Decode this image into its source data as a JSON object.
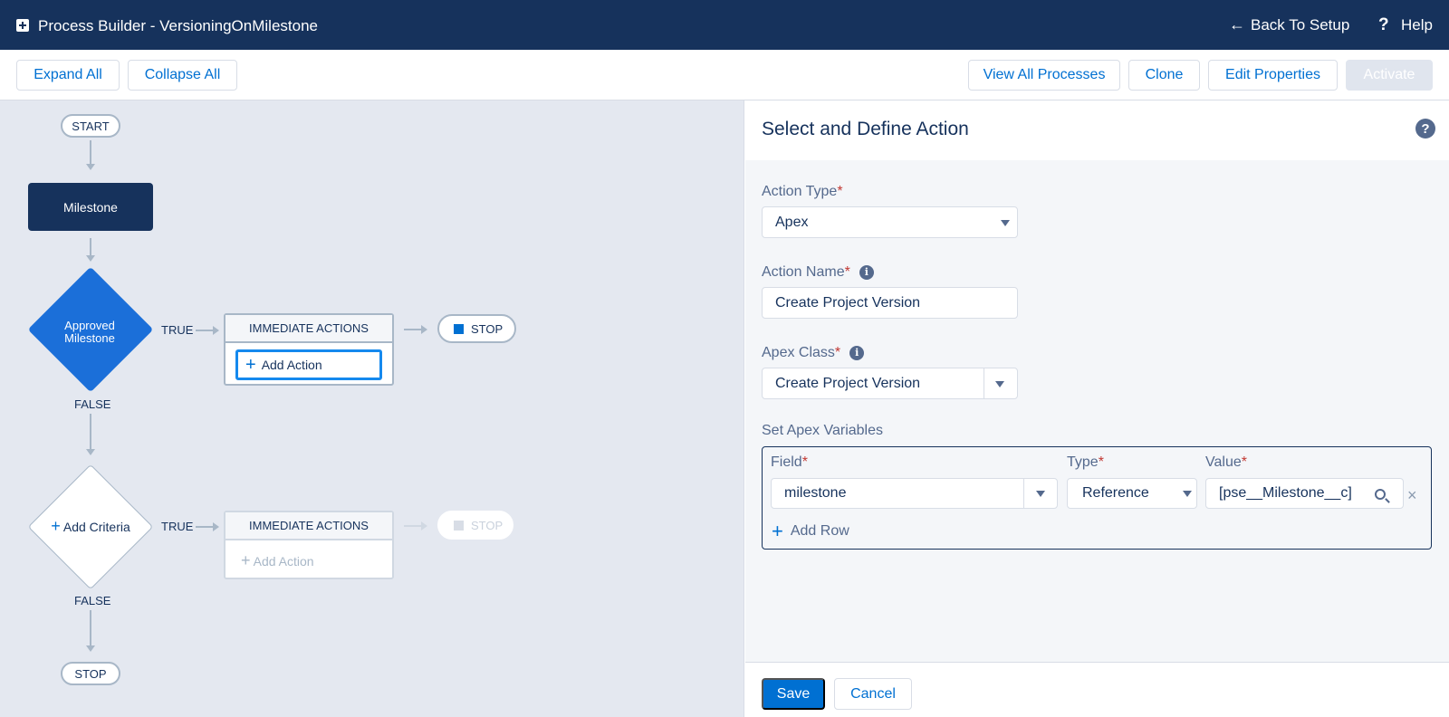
{
  "header": {
    "title": "Process Builder - VersioningOnMilestone",
    "back_label": "Back To Setup",
    "help_label": "Help"
  },
  "toolbar": {
    "expand_all": "Expand All",
    "collapse_all": "Collapse All",
    "view_all_processes": "View All Processes",
    "clone": "Clone",
    "edit_properties": "Edit Properties",
    "activate": "Activate"
  },
  "canvas": {
    "start_label": "START",
    "object_node": "Milestone",
    "criteria_1": {
      "label": "Approved Milestone",
      "true_label": "TRUE",
      "false_label": "FALSE",
      "immediate_actions": "IMMEDIATE ACTIONS",
      "add_action": "Add Action",
      "stop_label": "STOP"
    },
    "criteria_2": {
      "label": "Add Criteria",
      "true_label": "TRUE",
      "false_label": "FALSE",
      "immediate_actions": "IMMEDIATE ACTIONS",
      "add_action": "Add Action",
      "stop_label": "STOP"
    },
    "end_stop_label": "STOP"
  },
  "panel": {
    "title": "Select and Define Action",
    "action_type": {
      "label": "Action Type",
      "value": "Apex"
    },
    "action_name": {
      "label": "Action Name",
      "value": "Create Project Version"
    },
    "apex_class": {
      "label": "Apex Class",
      "value": "Create Project Version"
    },
    "apex_variables": {
      "label": "Set Apex Variables",
      "field_label": "Field",
      "type_label": "Type",
      "value_label": "Value",
      "rows": [
        {
          "field": "milestone",
          "type": "Reference",
          "value": "[pse__Milestone__c]"
        }
      ],
      "add_row": "Add Row"
    },
    "save": "Save",
    "cancel": "Cancel"
  },
  "colors": {
    "header_bg": "#16325c",
    "accent": "#0070d2",
    "canvas_bg": "#e4e8f0",
    "criteria_fill": "#1b6fd9"
  }
}
